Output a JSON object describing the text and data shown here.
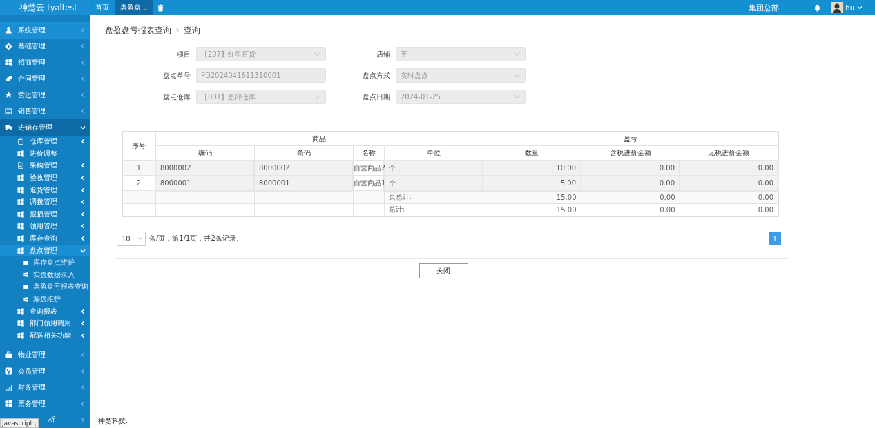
{
  "sidebar": {
    "logo": "神楚云-tyaltest",
    "items": [
      {
        "label": "系统管理",
        "selected": true,
        "expanded": false
      },
      {
        "label": "基础管理",
        "selected": false,
        "expanded": false
      },
      {
        "label": "招商管理",
        "selected": false,
        "expanded": false
      },
      {
        "label": "合同管理",
        "selected": false,
        "expanded": false
      },
      {
        "label": "营运管理",
        "selected": false,
        "expanded": false
      },
      {
        "label": "销售管理",
        "selected": false,
        "expanded": false
      },
      {
        "label": "进销存管理",
        "selected": false,
        "expanded": true,
        "children": [
          {
            "label": "仓库管理",
            "selected": false,
            "expanded": false
          },
          {
            "label": "进价调整",
            "selected": false
          },
          {
            "label": "采购管理",
            "selected": false,
            "expanded": false
          },
          {
            "label": "验收管理",
            "selected": false,
            "expanded": false
          },
          {
            "label": "退货管理",
            "selected": false,
            "expanded": false
          },
          {
            "label": "调拨管理",
            "selected": false,
            "expanded": false
          },
          {
            "label": "报损管理",
            "selected": false,
            "expanded": false
          },
          {
            "label": "领用管理",
            "selected": false,
            "expanded": false
          },
          {
            "label": "库存查询",
            "selected": false,
            "expanded": false
          },
          {
            "label": "盘点管理",
            "selected": true,
            "expanded": true,
            "children": [
              {
                "label": "库存盘点维护",
                "selected": false
              },
              {
                "label": "实盘数据录入",
                "selected": false
              },
              {
                "label": "盘盈盘亏报表查询",
                "selected": false
              },
              {
                "label": "漏盘维护",
                "selected": false
              }
            ]
          },
          {
            "label": "查询报表",
            "selected": false,
            "expanded": false
          },
          {
            "label": "部门领用调用",
            "selected": false,
            "expanded": false
          },
          {
            "label": "配送相关功能",
            "selected": false,
            "expanded": false
          }
        ]
      },
      {
        "label": "物业管理",
        "selected": false,
        "expanded": false
      },
      {
        "label": "会员管理",
        "selected": false,
        "expanded": false
      },
      {
        "label": "财务管理",
        "selected": false,
        "expanded": false
      },
      {
        "label": "票务管理",
        "selected": false,
        "expanded": false
      },
      {
        "label": "析",
        "selected": false,
        "expanded": false
      }
    ],
    "status_tooltip": "javascript:;"
  },
  "topbar": {
    "tabs": [
      {
        "label": "首页",
        "selected": false
      },
      {
        "label": "盘盈盘...",
        "selected": true
      }
    ],
    "organization": "集团总部",
    "user": "hu"
  },
  "breadcrumb": [
    "盘盈盘亏报表查询",
    "查询"
  ],
  "form": [
    {
      "label": "项目",
      "value": "【207】红星百货",
      "kind": "select"
    },
    {
      "label": "店铺",
      "value": "无",
      "kind": "select"
    },
    {
      "label": "盘点单号",
      "value": "PD2024041611310001",
      "kind": "text"
    },
    {
      "label": "盘点方式",
      "value": "实时盘点",
      "kind": "select"
    },
    {
      "label": "盘点仓库",
      "value": "【001】总部仓库",
      "kind": "select"
    },
    {
      "label": "盘点日期",
      "value": "2024-01-25",
      "kind": "select"
    }
  ],
  "table": {
    "index_header": "序号",
    "groups": [
      "商品",
      "盈亏"
    ],
    "columns": [
      "编码",
      "条码",
      "名称",
      "单位",
      "数量",
      "含税进价金额",
      "无税进价金额"
    ],
    "rows": [
      {
        "index": "1",
        "code": "8000002",
        "barcode": "8000002",
        "name": "自营商品2",
        "unit": "个",
        "qty": "10.00",
        "tax_amount": "0.00",
        "notax_amount": "0.00"
      },
      {
        "index": "2",
        "code": "8000001",
        "barcode": "8000001",
        "name": "自营商品1",
        "unit": "个",
        "qty": "5.00",
        "tax_amount": "0.00",
        "notax_amount": "0.00"
      }
    ],
    "totals": [
      {
        "label": "页总计:",
        "qty": "15.00",
        "tax_amount": "0.00",
        "notax_amount": "0.00"
      },
      {
        "label": "总计:",
        "qty": "15.00",
        "tax_amount": "0.00",
        "notax_amount": "0.00"
      }
    ]
  },
  "pagination": {
    "page_size": "10",
    "info": "条/页，第1/1页，共2条记录。",
    "pages": [
      {
        "label": "1",
        "selected": true
      }
    ]
  },
  "close_button": "关闭",
  "footer": "神楚科技."
}
